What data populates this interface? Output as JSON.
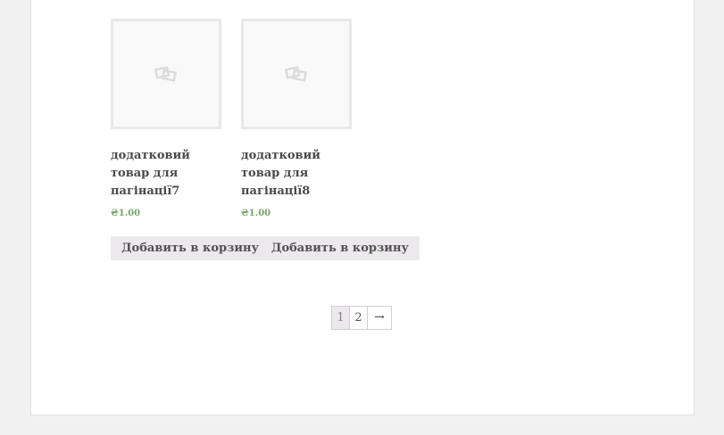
{
  "products": [
    {
      "title": "додатковий товар для пагінації7",
      "price": "₴1.00",
      "button": "Добавить в корзину",
      "thumbnail_icon": "placeholder-image-icon"
    },
    {
      "title": "додатковий товар для пагінації8",
      "price": "₴1.00",
      "button": "Добавить в корзину",
      "thumbnail_icon": "placeholder-image-icon"
    }
  ],
  "pagination": {
    "pages": [
      "1",
      "2"
    ],
    "current": "1",
    "next": "→"
  },
  "colors": {
    "price": "#77a464",
    "button_bg": "#ebe9eb",
    "page_bg": "#f1f1f1"
  }
}
